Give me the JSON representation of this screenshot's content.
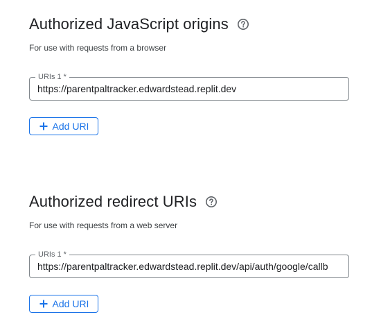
{
  "colors": {
    "accent": "#1a73e8",
    "text": "#202124",
    "secondary_text": "#5f6368",
    "border": "#80868b"
  },
  "js_origins": {
    "title": "Authorized JavaScript origins",
    "help_icon": "help-circle-icon",
    "subtitle": "For use with requests from a browser",
    "uri_label": "URIs 1 *",
    "uri_value": "https://parentpaltracker.edwardstead.replit.dev",
    "add_button_icon": "plus-icon",
    "add_button_label": "Add URI"
  },
  "redirect_uris": {
    "title": "Authorized redirect URIs",
    "help_icon": "help-circle-icon",
    "subtitle": "For use with requests from a web server",
    "uri_label": "URIs 1 *",
    "uri_value": "https://parentpaltracker.edwardstead.replit.dev/api/auth/google/callb",
    "add_button_icon": "plus-icon",
    "add_button_label": "Add URI"
  }
}
